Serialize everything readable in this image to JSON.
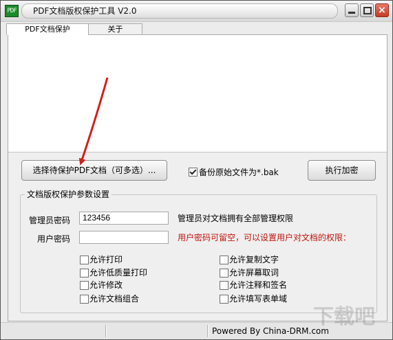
{
  "window": {
    "title": "PDF文档版权保护工具 V2.0",
    "icon": "app-icon",
    "icon_text": "PDF",
    "controls": [
      "minimize-icon",
      "maximize-icon",
      "close-icon"
    ],
    "close_glyph": "×"
  },
  "tabs": [
    {
      "label": "PDF文档保护",
      "active": true
    },
    {
      "label": "关于",
      "active": false
    }
  ],
  "actions": {
    "select_button": "选择待保护PDF文档（可多选）...",
    "backup_label": "备份原始文件为*.bak",
    "backup_checked": true,
    "execute_button": "执行加密"
  },
  "settings": {
    "group_title": "文档版权保护参数设置",
    "admin_password_label": "管理员密码",
    "admin_password_value": "123456",
    "admin_note": "管理员对文档拥有全部管理权限",
    "user_password_label": "用户密码",
    "user_password_value": "",
    "user_note": "用户密码可留空，可以设置用户对文档的权限："
  },
  "permissions": [
    {
      "label": "允许打印",
      "checked": false
    },
    {
      "label": "允许低质量打印",
      "checked": false
    },
    {
      "label": "允许修改",
      "checked": false
    },
    {
      "label": "允许文档组合",
      "checked": false
    },
    {
      "label": "允许复制文字",
      "checked": false
    },
    {
      "label": "允许屏幕取词",
      "checked": false
    },
    {
      "label": "允许注释和签名",
      "checked": false
    },
    {
      "label": "允许填写表单域",
      "checked": false
    }
  ],
  "status": {
    "text": "Powered By China-DRM.com"
  },
  "watermark": {
    "text": "下载吧"
  },
  "colors": {
    "note_red": "#c2140c",
    "arrow": "#d0201b",
    "app_icon": "#1c8a2a"
  }
}
